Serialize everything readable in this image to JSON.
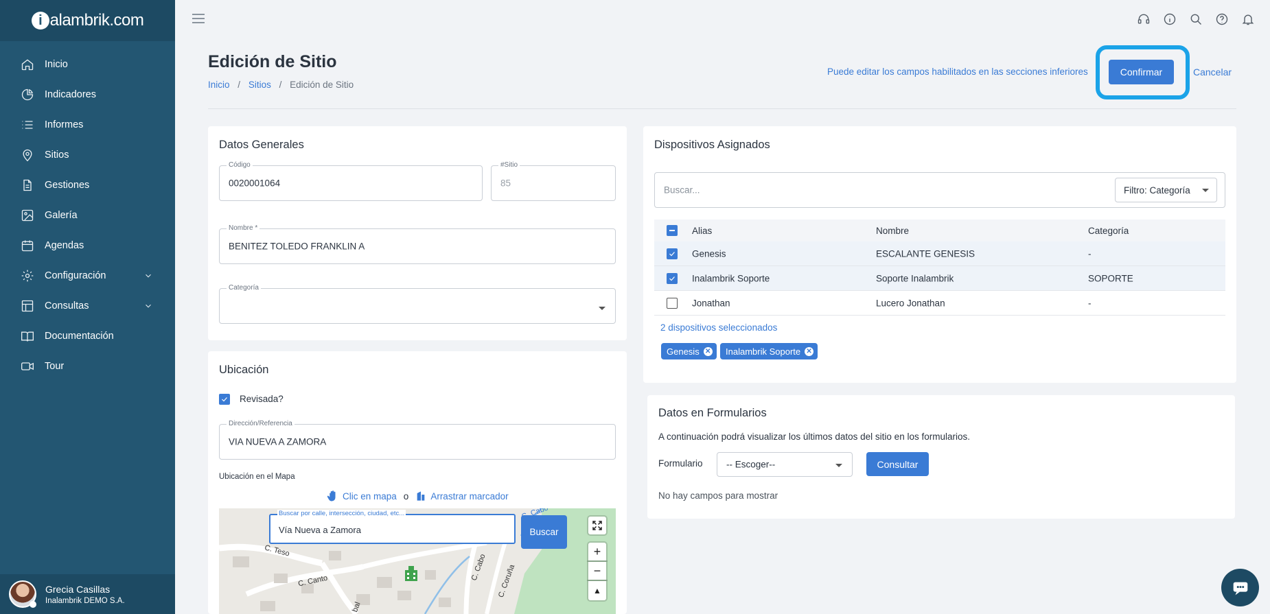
{
  "app": {
    "logo_text": "alambrik.com",
    "logo_mark": "i"
  },
  "sidebar": {
    "items": [
      {
        "label": "Inicio",
        "icon": "home-icon"
      },
      {
        "label": "Indicadores",
        "icon": "pie-chart-icon"
      },
      {
        "label": "Informes",
        "icon": "list-icon"
      },
      {
        "label": "Sitios",
        "icon": "map-pin-icon"
      },
      {
        "label": "Gestiones",
        "icon": "document-icon"
      },
      {
        "label": "Galería",
        "icon": "image-icon"
      },
      {
        "label": "Agendas",
        "icon": "calendar-icon"
      },
      {
        "label": "Configuración",
        "icon": "gear-icon"
      },
      {
        "label": "Consultas",
        "icon": "table-icon"
      },
      {
        "label": "Documentación",
        "icon": "book-icon"
      },
      {
        "label": "Tour",
        "icon": "video-icon"
      }
    ],
    "user": {
      "name": "Grecia Casillas",
      "org": "Inalambrik DEMO S.A."
    }
  },
  "header": {
    "title": "Edición de Sitio",
    "breadcrumb": [
      "Inicio",
      "Sitios",
      "Edición de Sitio"
    ],
    "hint": "Puede editar los campos habilitados en las secciones inferiores",
    "confirm_label": "Confirmar",
    "cancel_label": "Cancelar"
  },
  "datos_generales": {
    "title": "Datos Generales",
    "codigo_label": "Código",
    "codigo_value": "0020001064",
    "sitio_label": "#Sitio",
    "sitio_value": "85",
    "nombre_label": "Nombre *",
    "nombre_value": "BENITEZ TOLEDO FRANKLIN A",
    "categoria_label": "Categoría",
    "categoria_value": ""
  },
  "ubicacion": {
    "title": "Ubicación",
    "revisada_label": "Revisada?",
    "direccion_label": "Dirección/Referencia",
    "direccion_value": "VIA NUEVA A ZAMORA",
    "mapa_label": "Ubicación en el Mapa",
    "clic_label": "Clic en mapa",
    "o_label": "o",
    "arrastrar_label": "Arrastrar marcador",
    "search_label": "Buscar por calle, intersección, ciudad, etc...",
    "search_value": "Vía Nueva a Zamora",
    "buscar_label": "Buscar",
    "streets": [
      "C. Teso",
      "C. Canto",
      "C. Cabo",
      "C. Coruña",
      "C. Cabo",
      "bal"
    ]
  },
  "dispositivos": {
    "title": "Dispositivos Asignados",
    "search_placeholder": "Buscar...",
    "filter_label": "Filtro: Categoría",
    "columns": [
      "Alias",
      "Nombre",
      "Categoría"
    ],
    "rows": [
      {
        "alias": "Genesis",
        "nombre": "ESCALANTE GENESIS",
        "categoria": "-",
        "checked": true
      },
      {
        "alias": "Inalambrik Soporte",
        "nombre": "Soporte Inalambrik",
        "categoria": "SOPORTE",
        "checked": true
      },
      {
        "alias": "Jonathan",
        "nombre": "Lucero Jonathan",
        "categoria": "-",
        "checked": false
      }
    ],
    "selected_count": "2 dispositivos seleccionados",
    "chips": [
      "Genesis",
      "Inalambrik Soporte"
    ]
  },
  "formularios": {
    "title": "Datos en Formularios",
    "description": "A continuación podrá visualizar los últimos datos del sitio en los formularios.",
    "formulario_label": "Formulario",
    "select_value": "-- Escoger--",
    "consultar_label": "Consultar",
    "empty_text": "No hay campos para mostrar"
  },
  "colors": {
    "sidebar": "#235672",
    "accent": "#3a7bd5",
    "highlight": "#1ba3e8"
  }
}
